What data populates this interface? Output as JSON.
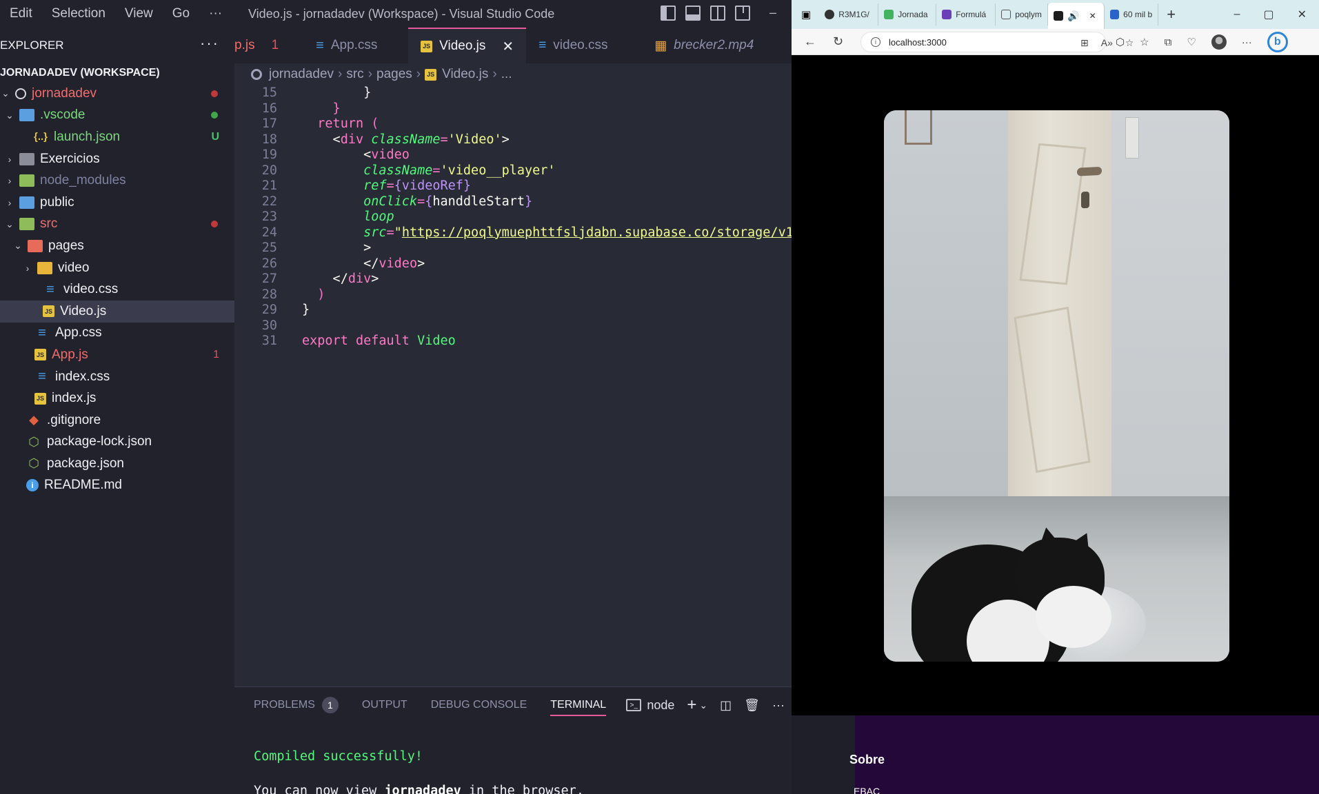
{
  "vscode": {
    "menu": [
      "Edit",
      "Selection",
      "View",
      "Go",
      "···"
    ],
    "window_title": "Video.js - jornadadev (Workspace) - Visual Studio Code",
    "minimize_glyph": "–"
  },
  "explorer": {
    "header": "EXPLORER",
    "more": "···",
    "workspace": "JORNADADEV (WORKSPACE)",
    "items": [
      {
        "label": "jornadadev",
        "chev": "⌄",
        "indent": 0
      },
      {
        "label": ".vscode",
        "chev": "⌄",
        "indent": 1
      },
      {
        "label": "launch.json",
        "chev": "",
        "indent": 2,
        "deco": "U"
      },
      {
        "label": "Exercicios",
        "chev": "›",
        "indent": 1
      },
      {
        "label": "node_modules",
        "chev": "›",
        "indent": 1
      },
      {
        "label": "public",
        "chev": "›",
        "indent": 1
      },
      {
        "label": "src",
        "chev": "⌄",
        "indent": 1
      },
      {
        "label": "pages",
        "chev": "⌄",
        "indent": 2
      },
      {
        "label": "video",
        "chev": "›",
        "indent": 3
      },
      {
        "label": "video.css",
        "chev": "",
        "indent": 3
      },
      {
        "label": "Video.js",
        "chev": "",
        "indent": 3
      },
      {
        "label": "App.css",
        "chev": "",
        "indent": 2
      },
      {
        "label": "App.js",
        "chev": "",
        "indent": 2,
        "deco": "1"
      },
      {
        "label": "index.css",
        "chev": "",
        "indent": 2
      },
      {
        "label": "index.js",
        "chev": "",
        "indent": 2
      },
      {
        "label": ".gitignore",
        "chev": "",
        "indent": 1
      },
      {
        "label": "package-lock.json",
        "chev": "",
        "indent": 1
      },
      {
        "label": "package.json",
        "chev": "",
        "indent": 1
      },
      {
        "label": "README.md",
        "chev": "",
        "indent": 1
      }
    ]
  },
  "tabs": [
    {
      "label": "p.js",
      "badge": "1"
    },
    {
      "label": "App.css"
    },
    {
      "label": "Video.js",
      "close": "✕"
    },
    {
      "label": "video.css"
    },
    {
      "label": "brecker2.mp4"
    }
  ],
  "breadcrumb": [
    "jornadadev",
    "src",
    "pages",
    "Video.js",
    "..."
  ],
  "editor": {
    "line_numbers": [
      "15",
      "16",
      "17",
      "18",
      "19",
      "20",
      "21",
      "22",
      "23",
      "24",
      "25",
      "26",
      "27",
      "28",
      "29",
      "30",
      "31"
    ]
  },
  "panel": {
    "tabs": [
      "PROBLEMS",
      "OUTPUT",
      "DEBUG CONSOLE",
      "TERMINAL"
    ],
    "problems_count": "1",
    "terminal_profile": "node",
    "terminal_lines": {
      "compiled": "Compiled successfully!",
      "view_prefix": "You can now view ",
      "view_app": "jornadadev",
      "view_suffix": " in the browser."
    }
  },
  "browser": {
    "tabs": [
      "R3M1G/",
      "Jornada",
      "Formulá",
      "poqlym",
      "",
      "60 mil b"
    ],
    "address": "localhost:3000",
    "window_controls": [
      "–",
      "▢",
      "✕"
    ]
  },
  "background_page": {
    "heading": "Sobre",
    "link": "EBAC"
  }
}
